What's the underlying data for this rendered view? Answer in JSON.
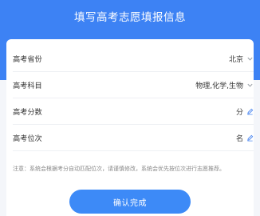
{
  "header": {
    "title": "填写高考志愿填报信息"
  },
  "form": {
    "rows": [
      {
        "label": "高考省份",
        "value": "北京",
        "icon": "chevron-down-icon"
      },
      {
        "label": "高考科目",
        "value": "物理,化学,生物",
        "icon": "chevron-down-icon"
      },
      {
        "label": "高考分数",
        "value": "分",
        "icon": "pencil-icon"
      },
      {
        "label": "高考位次",
        "value": "名",
        "icon": "pencil-icon"
      }
    ],
    "note": "注意：系统会根据考分自动匹配位次，请谨慎修改，系统会优先按位次进行志愿推荐。"
  },
  "actions": {
    "confirm_label": "确认完成"
  },
  "colors": {
    "primary": "#3d82f4",
    "accent_icon": "#4a86f0"
  }
}
